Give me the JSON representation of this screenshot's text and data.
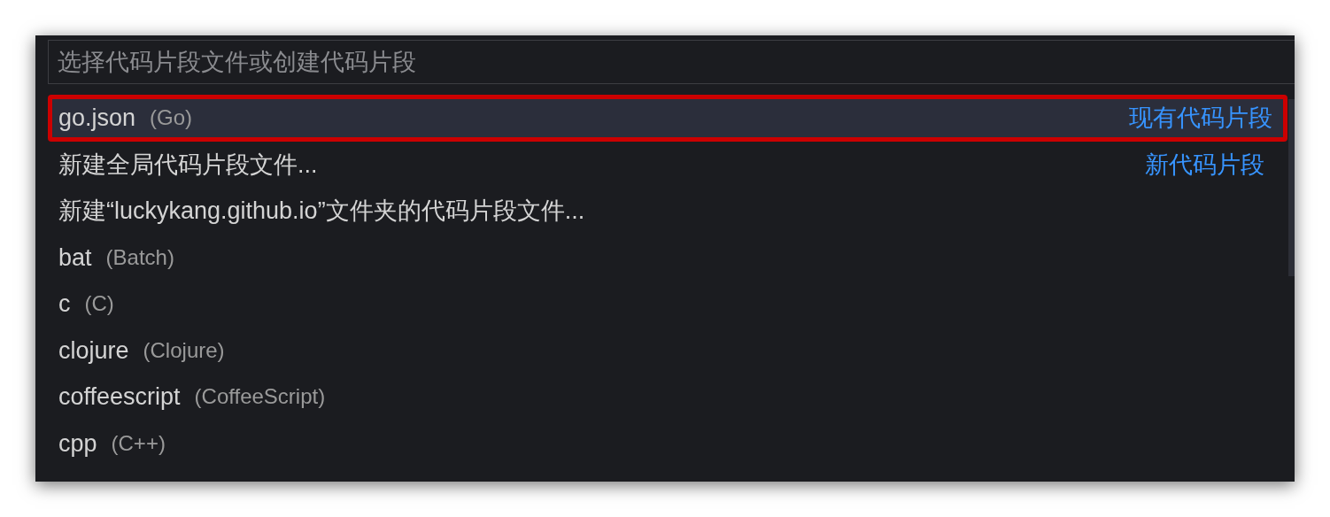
{
  "search": {
    "placeholder": "选择代码片段文件或创建代码片段"
  },
  "items": [
    {
      "label": "go.json",
      "detail": "(Go)",
      "group": "现有代码片段",
      "selected": true,
      "annotated": true
    },
    {
      "label": "新建全局代码片段文件...",
      "group": "新代码片段",
      "selected": false,
      "annotated": false
    },
    {
      "label": "新建“luckykang.github.io”文件夹的代码片段文件...",
      "selected": false,
      "annotated": false
    },
    {
      "label": "bat",
      "detail": "(Batch)",
      "selected": false,
      "annotated": false
    },
    {
      "label": "c",
      "detail": "(C)",
      "selected": false,
      "annotated": false
    },
    {
      "label": "clojure",
      "detail": "(Clojure)",
      "selected": false,
      "annotated": false
    },
    {
      "label": "coffeescript",
      "detail": "(CoffeeScript)",
      "selected": false,
      "annotated": false
    },
    {
      "label": "cpp",
      "detail": "(C++)",
      "selected": false,
      "annotated": false
    }
  ]
}
